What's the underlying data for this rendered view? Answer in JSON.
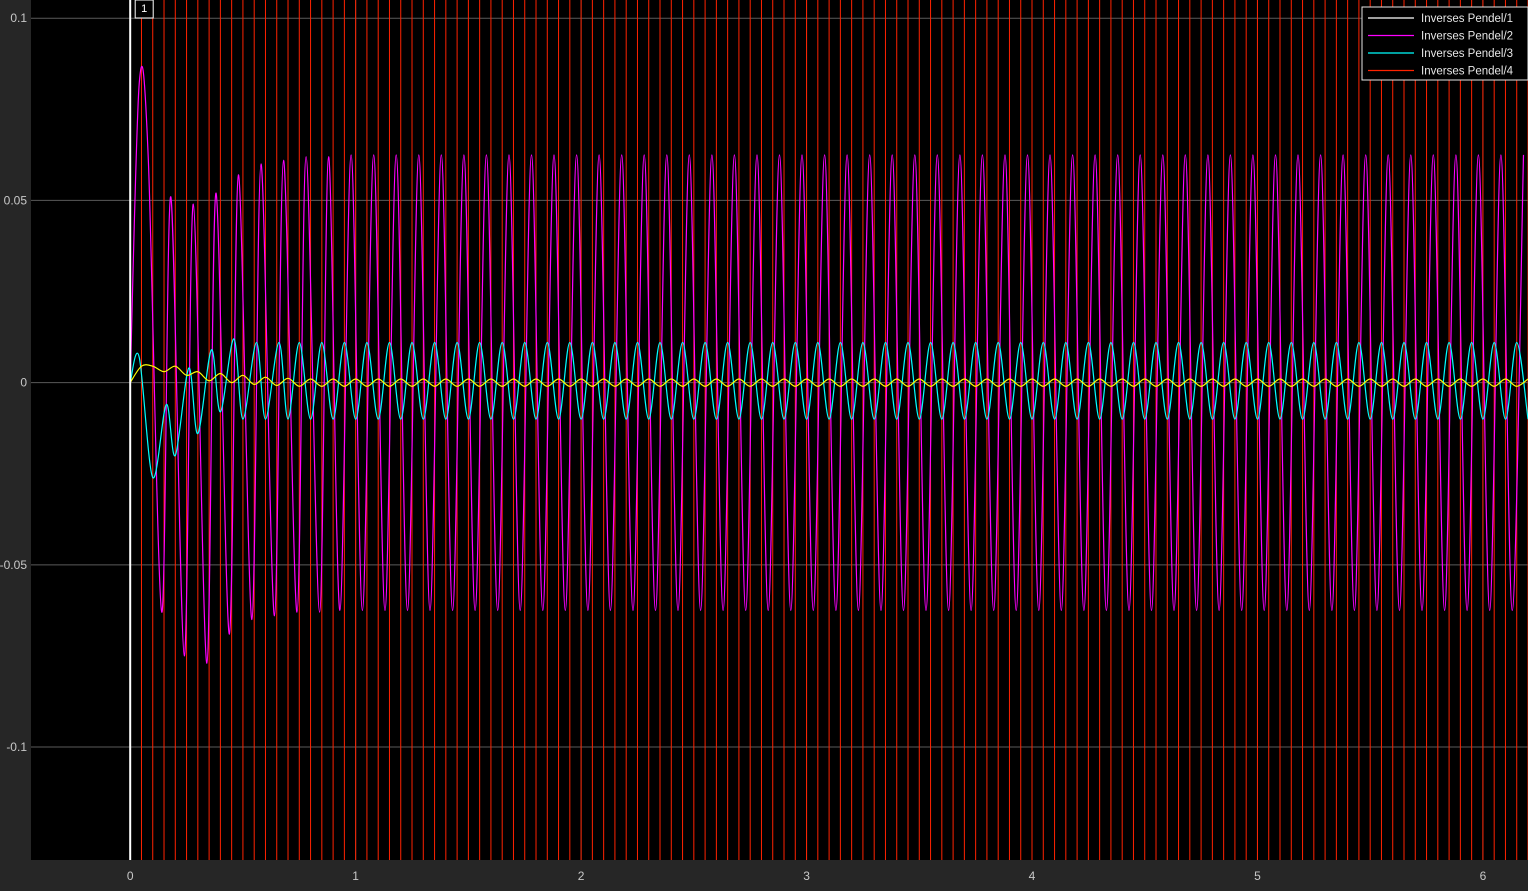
{
  "chart_data": {
    "type": "line",
    "title": "",
    "xlabel": "",
    "ylabel": "",
    "xlim": [
      -0.44,
      6.2
    ],
    "ylim": [
      -0.131,
      0.105
    ],
    "grid": true,
    "legend_position": "top-right",
    "x_ticks": [
      {
        "value": 0,
        "label": "0"
      },
      {
        "value": 1,
        "label": "1"
      },
      {
        "value": 2,
        "label": "2"
      },
      {
        "value": 3,
        "label": "3"
      },
      {
        "value": 4,
        "label": "4"
      },
      {
        "value": 5,
        "label": "5"
      },
      {
        "value": 6,
        "label": "6"
      }
    ],
    "y_ticks": [
      {
        "value": 0.1,
        "label": "0.1"
      },
      {
        "value": 0.05,
        "label": "0.05"
      },
      {
        "value": 0,
        "label": "0"
      },
      {
        "value": -0.05,
        "label": "-0.05"
      },
      {
        "value": -0.1,
        "label": "-0.1"
      }
    ],
    "cursor": {
      "label": "1",
      "x": 0
    },
    "colors": {
      "figure_bg": "#262626",
      "axes_bg": "#000000",
      "grid": "#5a5a5a",
      "tick_text": "#c8c8c8",
      "legend_bg": "#000000",
      "legend_text": "#e6e6e6",
      "legend_border": "#e6e6e6",
      "cursor": "#ffffff"
    },
    "series": [
      {
        "name": "Inverses Pendel/1",
        "color": "#ffff00",
        "legend_color": "#ffffff",
        "points": [
          [
            0,
            0
          ],
          [
            0.05,
            0.0045
          ],
          [
            0.1,
            0.0045
          ],
          [
            0.15,
            0.003
          ],
          [
            0.2,
            0.0045
          ],
          [
            0.25,
            0.002
          ],
          [
            0.3,
            0.003
          ],
          [
            0.35,
            0.0005
          ],
          [
            0.4,
            0.0025
          ],
          [
            0.45,
            0
          ],
          [
            0.5,
            0.002
          ],
          [
            0.55,
            -0.0005
          ],
          [
            0.6,
            0.0015
          ],
          [
            0.65,
            -0.0008
          ],
          [
            0.7,
            0.0012
          ],
          [
            0.75,
            -0.001
          ],
          [
            0.8,
            0.001
          ],
          [
            0.85,
            -0.001
          ],
          [
            0.9,
            0.001
          ]
        ],
        "steady_amplitude": 0.001,
        "steady_offset": 0,
        "period": 0.1
      },
      {
        "name": "Inverses Pendel/2",
        "color": "#ff00ff",
        "points": [
          [
            0,
            0
          ],
          [
            0.04,
            0.082
          ],
          [
            0.08,
            0.062
          ],
          [
            0.14,
            -0.063
          ],
          [
            0.18,
            0.051
          ],
          [
            0.24,
            -0.075
          ],
          [
            0.28,
            0.049
          ],
          [
            0.34,
            -0.077
          ],
          [
            0.38,
            0.052
          ],
          [
            0.44,
            -0.069
          ],
          [
            0.48,
            0.057
          ],
          [
            0.54,
            -0.065
          ],
          [
            0.58,
            0.06
          ],
          [
            0.64,
            -0.064
          ],
          [
            0.68,
            0.061
          ],
          [
            0.74,
            -0.063
          ],
          [
            0.78,
            0.062
          ],
          [
            0.84,
            -0.063
          ],
          [
            0.88,
            0.062
          ]
        ],
        "steady_amplitude": 0.0625,
        "steady_offset": 0,
        "period": 0.1
      },
      {
        "name": "Inverses Pendel/3",
        "color": "#00ffff",
        "points": [
          [
            0,
            0
          ],
          [
            0.04,
            0.007
          ],
          [
            0.1,
            -0.026
          ],
          [
            0.16,
            -0.006
          ],
          [
            0.2,
            -0.02
          ],
          [
            0.26,
            0.004
          ],
          [
            0.3,
            -0.014
          ],
          [
            0.36,
            0.009
          ],
          [
            0.4,
            -0.008
          ],
          [
            0.46,
            0.012
          ],
          [
            0.5,
            -0.01
          ],
          [
            0.56,
            0.011
          ],
          [
            0.6,
            -0.01
          ],
          [
            0.66,
            0.011
          ],
          [
            0.7,
            -0.01
          ]
        ],
        "steady_amplitude": 0.0105,
        "steady_offset": 0.0005,
        "period": 0.1
      },
      {
        "name": "Inverses Pendel/4",
        "color": "#ff2200",
        "vertical_lines": true,
        "first_x": 0.05,
        "spacing": 0.05
      }
    ]
  }
}
